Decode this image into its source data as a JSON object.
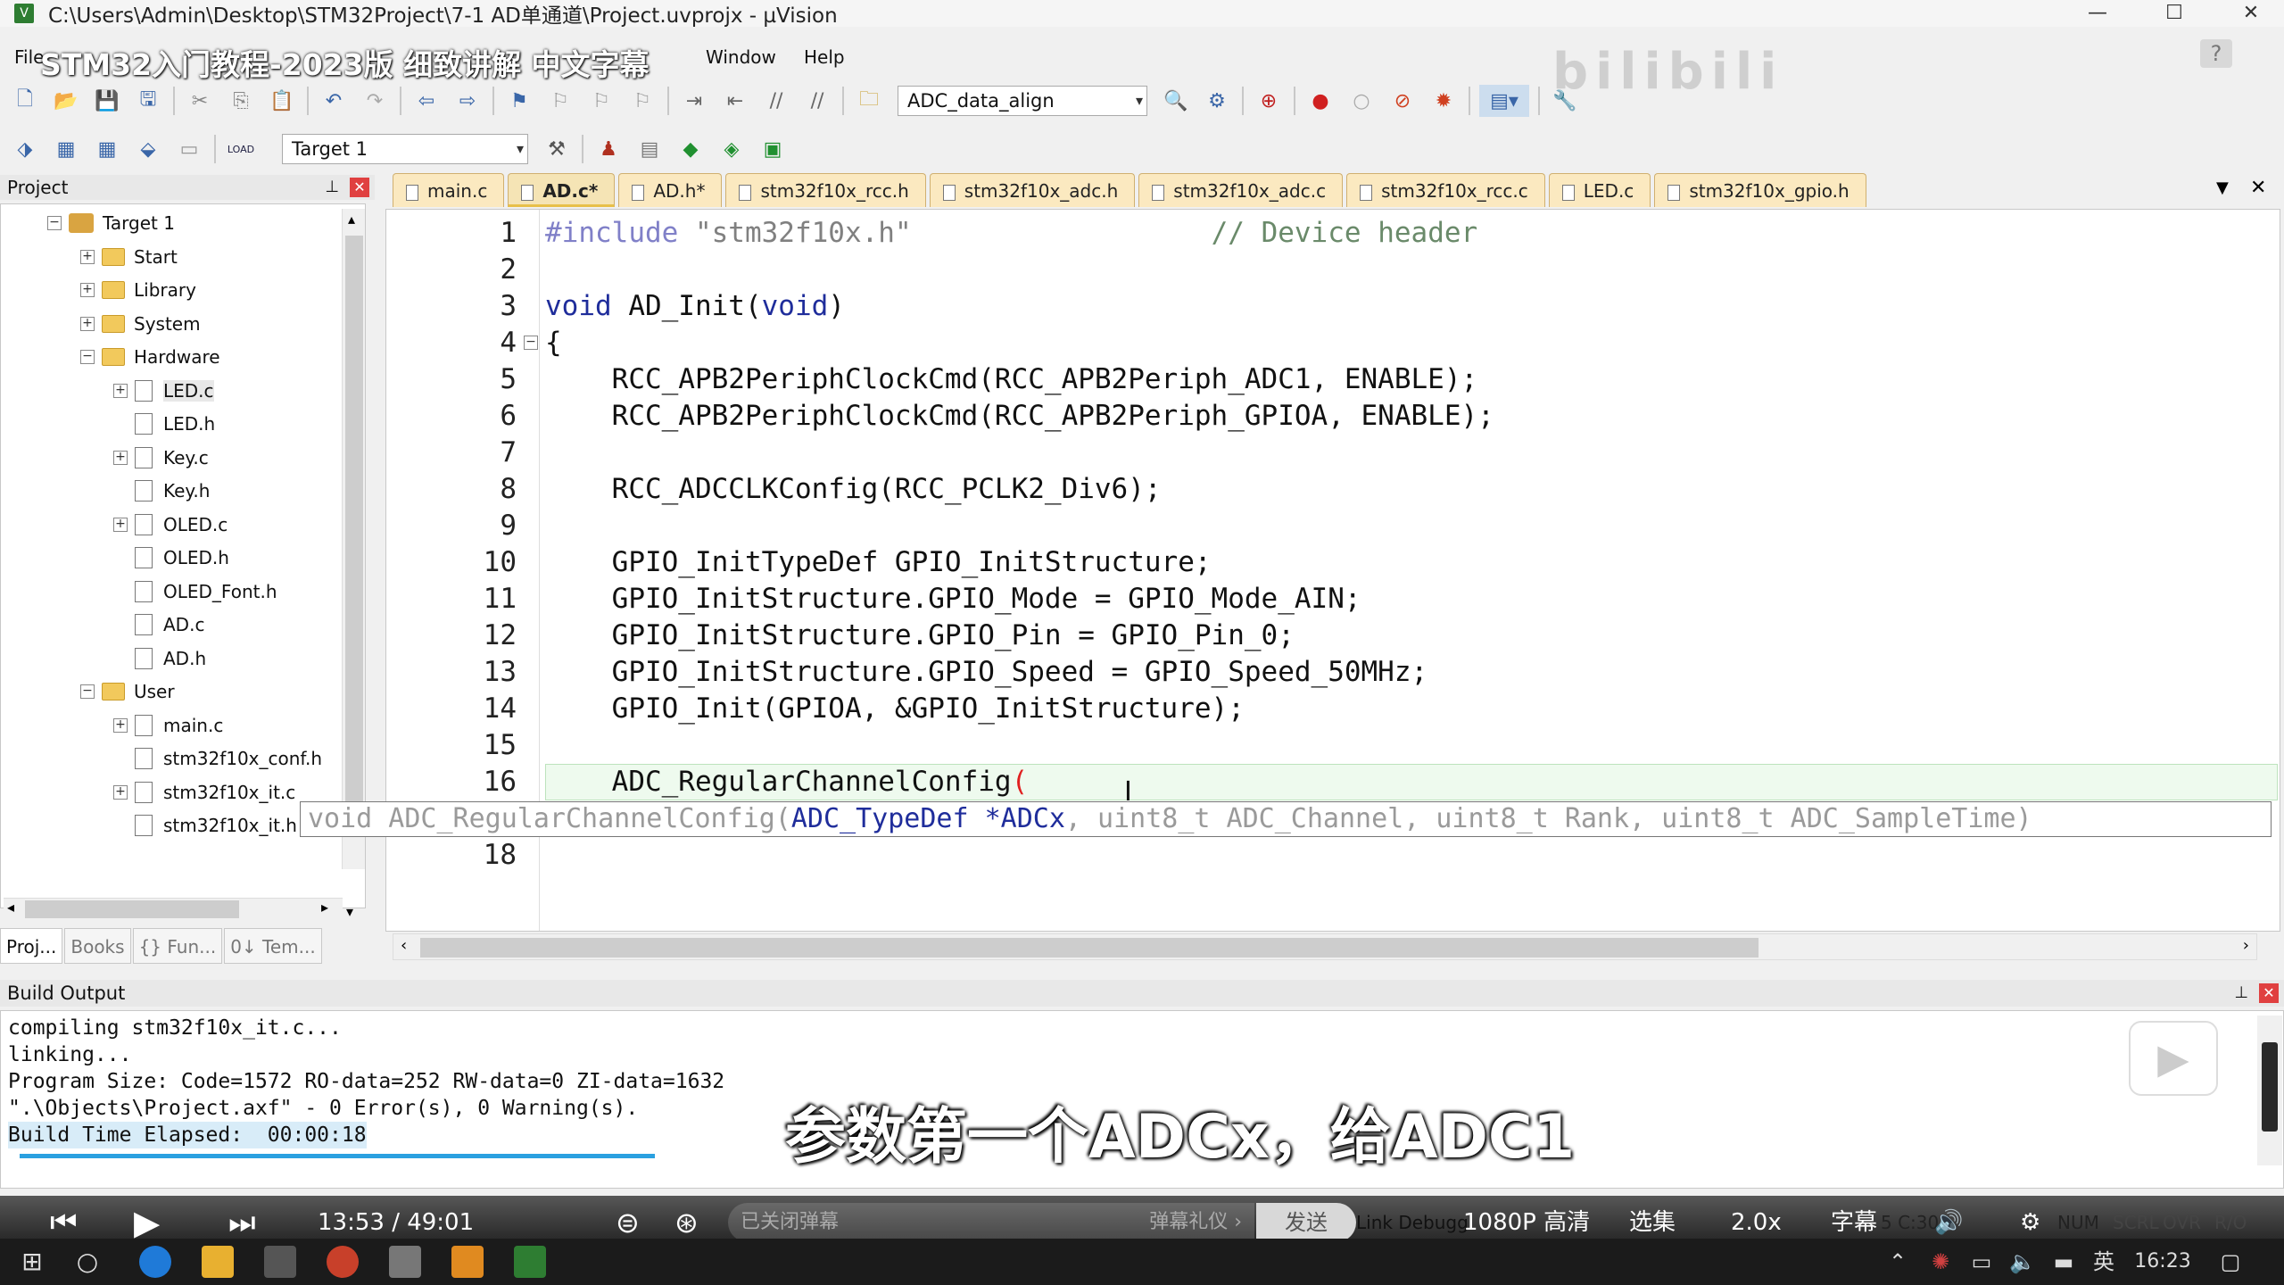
{
  "window": {
    "title": "C:\\Users\\Admin\\Desktop\\STM32Project\\7-1 AD单通道\\Project.uvprojx - µVision",
    "app_icon": "uv-icon",
    "controls": [
      "—",
      "☐",
      "✕"
    ]
  },
  "menu": {
    "file": "File",
    "window": "Window",
    "help": "Help"
  },
  "overlay": {
    "video_title": "STM32入门教程-2023版 细致讲解 中文字幕",
    "help_glyph": "?",
    "watermark": "bilibili"
  },
  "toolbar1": {
    "combo_value": "ADC_data_align",
    "combo_arrow": "▾"
  },
  "toolbar2": {
    "load_label": "LOAD",
    "target_value": "Target 1",
    "combo_arrow": "▾"
  },
  "project_panel": {
    "title": "Project",
    "pin_glyph": "⊥",
    "close_glyph": "✕",
    "tree": [
      {
        "label": "Target 1",
        "type": "target",
        "expander": "−"
      },
      {
        "label": "Start",
        "type": "folder",
        "expander": "+"
      },
      {
        "label": "Library",
        "type": "folder",
        "expander": "+"
      },
      {
        "label": "System",
        "type": "folder",
        "expander": "+"
      },
      {
        "label": "Hardware",
        "type": "folder",
        "expander": "−"
      },
      {
        "label": "LED.c",
        "type": "file",
        "expander": "+"
      },
      {
        "label": "LED.h",
        "type": "file",
        "expander": ""
      },
      {
        "label": "Key.c",
        "type": "file",
        "expander": "+"
      },
      {
        "label": "Key.h",
        "type": "file",
        "expander": ""
      },
      {
        "label": "OLED.c",
        "type": "file",
        "expander": "+"
      },
      {
        "label": "OLED.h",
        "type": "file",
        "expander": ""
      },
      {
        "label": "OLED_Font.h",
        "type": "file",
        "expander": ""
      },
      {
        "label": "AD.c",
        "type": "file",
        "expander": ""
      },
      {
        "label": "AD.h",
        "type": "file",
        "expander": ""
      },
      {
        "label": "User",
        "type": "folder",
        "expander": "−"
      },
      {
        "label": "main.c",
        "type": "file",
        "expander": "+"
      },
      {
        "label": "stm32f10x_conf.h",
        "type": "file",
        "expander": ""
      },
      {
        "label": "stm32f10x_it.c",
        "type": "file",
        "expander": "+"
      },
      {
        "label": "stm32f10x_it.h",
        "type": "file",
        "expander": ""
      }
    ],
    "tabs": [
      "Proj...",
      "Books",
      "{} Fun...",
      "0↓ Tem..."
    ],
    "scroll_left": "◂",
    "scroll_right": "▸",
    "scroll_up": "▴",
    "scroll_down": "▾"
  },
  "editor": {
    "tabs": [
      {
        "label": "main.c",
        "active": false
      },
      {
        "label": "AD.c*",
        "active": true
      },
      {
        "label": "AD.h*",
        "active": false
      },
      {
        "label": "stm32f10x_rcc.h",
        "active": false
      },
      {
        "label": "stm32f10x_adc.h",
        "active": false
      },
      {
        "label": "stm32f10x_adc.c",
        "active": false
      },
      {
        "label": "stm32f10x_rcc.c",
        "active": false
      },
      {
        "label": "LED.c",
        "active": false
      },
      {
        "label": "stm32f10x_gpio.h",
        "active": false
      }
    ],
    "tab_menu": "▼",
    "tab_close": "✕",
    "fold_open": "−",
    "lines": [
      {
        "n": "1",
        "segs": [
          [
            "pre",
            "#include "
          ],
          [
            "str",
            "\"stm32f10x.h\""
          ],
          [
            "txt",
            "                  "
          ],
          [
            "com",
            "// Device header"
          ]
        ]
      },
      {
        "n": "2",
        "segs": []
      },
      {
        "n": "3",
        "segs": [
          [
            "kw",
            "void"
          ],
          [
            "txt",
            " AD_Init("
          ],
          [
            "kw",
            "void"
          ],
          [
            "txt",
            ")"
          ]
        ]
      },
      {
        "n": "4",
        "segs": [
          [
            "txt",
            "{"
          ]
        ]
      },
      {
        "n": "5",
        "segs": [
          [
            "txt",
            "    RCC_APB2PeriphClockCmd(RCC_APB2Periph_ADC1, ENABLE);"
          ]
        ]
      },
      {
        "n": "6",
        "segs": [
          [
            "txt",
            "    RCC_APB2PeriphClockCmd(RCC_APB2Periph_GPIOA, ENABLE);"
          ]
        ]
      },
      {
        "n": "7",
        "segs": []
      },
      {
        "n": "8",
        "segs": [
          [
            "txt",
            "    RCC_ADCCLKConfig(RCC_PCLK2_Div6);"
          ]
        ]
      },
      {
        "n": "9",
        "segs": []
      },
      {
        "n": "10",
        "segs": [
          [
            "txt",
            "    GPIO_InitTypeDef GPIO_InitStructure;"
          ]
        ]
      },
      {
        "n": "11",
        "segs": [
          [
            "txt",
            "    GPIO_InitStructure.GPIO_Mode = GPIO_Mode_AIN;"
          ]
        ]
      },
      {
        "n": "12",
        "segs": [
          [
            "txt",
            "    GPIO_InitStructure.GPIO_Pin = GPIO_Pin_0;"
          ]
        ]
      },
      {
        "n": "13",
        "segs": [
          [
            "txt",
            "    GPIO_InitStructure.GPIO_Speed = GPIO_Speed_50MHz;"
          ]
        ]
      },
      {
        "n": "14",
        "segs": [
          [
            "txt",
            "    GPIO_Init(GPIOA, &GPIO_InitStructure);"
          ]
        ]
      },
      {
        "n": "15",
        "segs": []
      },
      {
        "n": "16",
        "segs": [
          [
            "txt",
            "    ADC_RegularChannelConfig"
          ],
          [
            "paren",
            "("
          ]
        ]
      },
      {
        "n": "17",
        "segs": []
      },
      {
        "n": "18",
        "segs": []
      }
    ],
    "tooltip": {
      "before": "void ADC_RegularChannelConfig(",
      "active": "ADC_TypeDef *ADCx",
      "after": ", uint8_t ADC_Channel, uint8_t Rank, uint8_t ADC_SampleTime)"
    },
    "ibeam": "I",
    "scroll_left": "‹",
    "scroll_right": "›"
  },
  "build_output": {
    "title": "Build Output",
    "pin_glyph": "⊥",
    "close_glyph": "✕",
    "lines": [
      "compiling stm32f10x_it.c...",
      "linking...",
      "Program Size: Code=1572 RO-data=252 RW-data=0 ZI-data=1632",
      "\".\\Objects\\Project.axf\" - 0 Error(s), 0 Warning(s).",
      "Build Time Elapsed:  00:00:18"
    ],
    "progress": 1.0
  },
  "subtitle": "参数第一个ADCx，给ADC1",
  "video": {
    "prev": "⏮",
    "play": "▶",
    "next": "⏭",
    "time": "13:53 / 49:01",
    "danmaku_placeholder": "已关闭弹幕",
    "gift": "弹幕礼仪 ›",
    "send": "发送",
    "status_text": "Link Debugg",
    "quality": "1080P 高清",
    "episodes": "选集",
    "speed": "2.0x",
    "subtitle_btn": "字幕",
    "pos_text": "5 C:30",
    "vol": "🔊",
    "settings": "⚙",
    "num": "NUM",
    "scrl": "SCRL",
    "ovr": "OVR",
    "rw": "R/O"
  },
  "taskbar": {
    "clock": "16:23",
    "ime": "英"
  }
}
